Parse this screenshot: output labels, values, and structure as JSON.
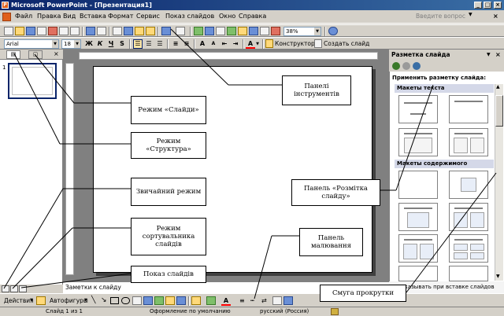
{
  "window": {
    "title": "Microsoft PowerPoint - [Презентация1]",
    "min": "_",
    "max": "□",
    "close": "×"
  },
  "menu": {
    "items": [
      "Файл",
      "Правка",
      "Вид",
      "Вставка",
      "Формат",
      "Сервис",
      "Показ слайдов",
      "Окно",
      "Справка"
    ],
    "ask_placeholder": "Введите вопрос",
    "doc_close": "×"
  },
  "toolbar_standard": {
    "zoom": "38%"
  },
  "toolbar_format": {
    "font": "Arial",
    "size": "18",
    "bold": "Ж",
    "italic": "К",
    "underline": "Ч",
    "shadow": "S",
    "designer": "Конструктор",
    "new_slide": "Создать слайд"
  },
  "left_pane": {
    "slide_number": "1"
  },
  "notes_placeholder": "Заметки к слайду",
  "task_pane": {
    "title": "Разметка слайда",
    "apply_label": "Применить разметку слайда:",
    "groups": [
      "Макеты текста",
      "Макеты содержимого"
    ],
    "footer": "Показывать при вставке слайдов"
  },
  "draw_toolbar": {
    "actions": "Действия",
    "autoshapes": "Автофигуры"
  },
  "status_bar": {
    "slide": "Слайд 1 из 1",
    "design": "Оформление по умолчанию",
    "language": "русский (Россия)"
  },
  "callouts": {
    "toolbars": "Панелі інструментів",
    "slides_mode": "Режим «Слайди»",
    "outline_mode": "Режим «Структура»",
    "normal_mode": "Звичайний режим",
    "sorter_mode": "Режим сортувальника слайдів",
    "show": "Показ слайдів",
    "layout_panel": "Панель «Розмітка слайду»",
    "drawing_panel": "Панель малювання",
    "scrollbar": "Смуга прокрутки"
  },
  "colors": {
    "titlebar_start": "#0a246a",
    "titlebar_end": "#3a6ea5",
    "chrome": "#d4d0c8",
    "slide_bg": "#808080"
  }
}
